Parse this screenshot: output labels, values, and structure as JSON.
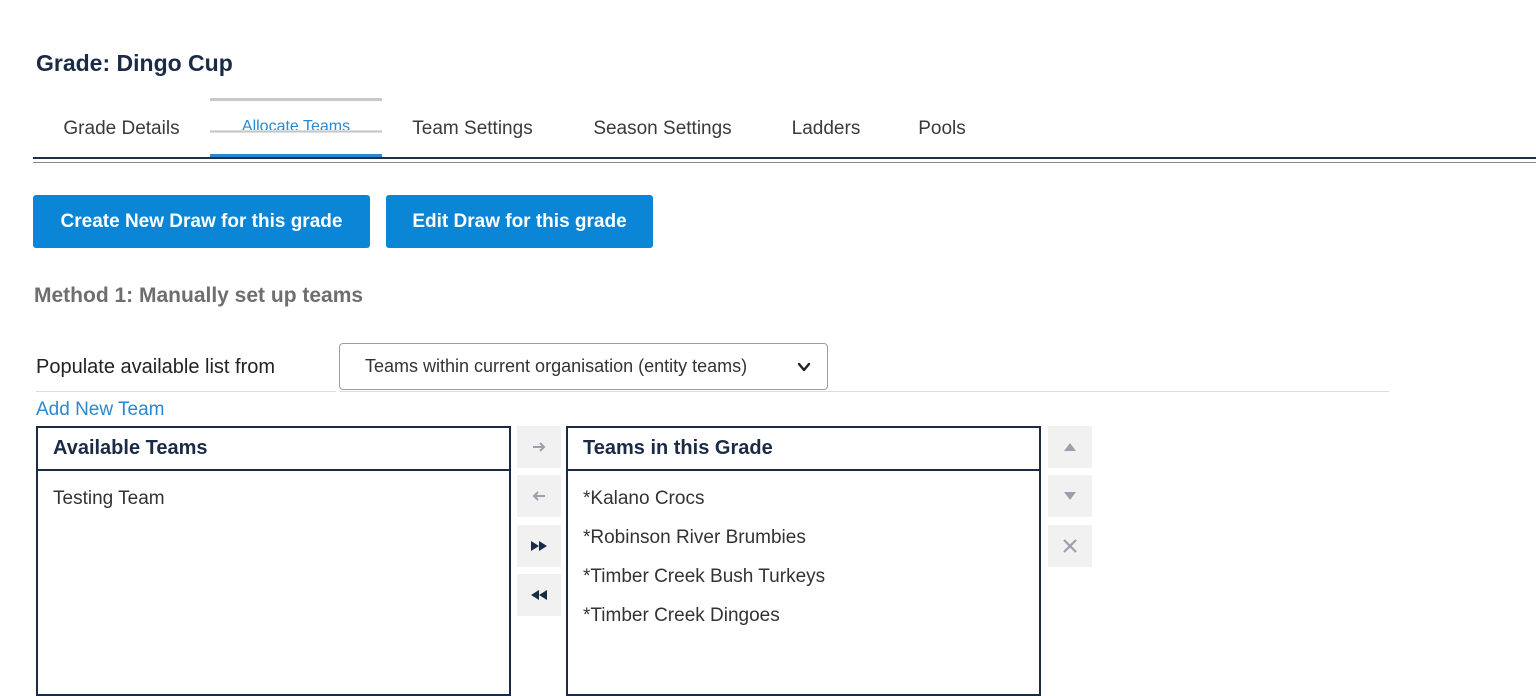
{
  "page": {
    "title": "Grade: Dingo Cup"
  },
  "tabs": [
    {
      "label": "Grade Details"
    },
    {
      "label": "Allocate Teams",
      "active": true
    },
    {
      "label": "Team Settings"
    },
    {
      "label": "Season Settings"
    },
    {
      "label": "Ladders"
    },
    {
      "label": "Pools"
    }
  ],
  "actions": {
    "create_draw": "Create New Draw for this grade",
    "edit_draw": "Edit Draw for this grade"
  },
  "method": {
    "heading": "Method 1: Manually set up teams",
    "populate_label": "Populate available list from",
    "populate_selected": "Teams within current organisation (entity teams)",
    "add_team_link": "Add New Team"
  },
  "available": {
    "header": "Available Teams",
    "items": [
      "Testing Team"
    ]
  },
  "grade_teams": {
    "header": "Teams in this Grade",
    "items": [
      "*Kalano Crocs",
      "*Robinson River Brumbies",
      "*Timber Creek Bush Turkeys",
      "*Timber Creek Dingoes"
    ]
  },
  "colors": {
    "accent": "#0b86d6",
    "tab_active": "#2a88d0",
    "navy": "#1b2b45",
    "muted_heading": "#6e6e6e"
  },
  "icons": {
    "move_right": "arrow-right-icon",
    "move_left": "arrow-left-icon",
    "move_all_right": "double-chevron-right-icon",
    "move_all_left": "double-chevron-left-icon",
    "move_up": "triangle-up-icon",
    "move_down": "triangle-down-icon",
    "remove": "close-icon",
    "dropdown": "chevron-down-icon"
  }
}
